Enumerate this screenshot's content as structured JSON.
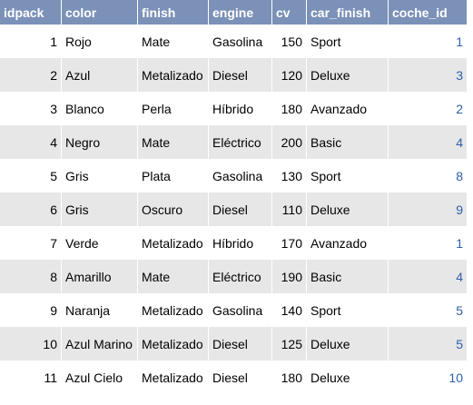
{
  "table": {
    "columns": [
      "idpack",
      "color",
      "finish",
      "engine",
      "cv",
      "car_finish",
      "coche_id"
    ],
    "rows": [
      {
        "idpack": "1",
        "color": "Rojo",
        "finish": "Mate",
        "engine": "Gasolina",
        "cv": "150",
        "car_finish": "Sport",
        "coche_id": "1"
      },
      {
        "idpack": "2",
        "color": "Azul",
        "finish": "Metalizado",
        "engine": "Diesel",
        "cv": "120",
        "car_finish": "Deluxe",
        "coche_id": "3"
      },
      {
        "idpack": "3",
        "color": "Blanco",
        "finish": "Perla",
        "engine": "Híbrido",
        "cv": "180",
        "car_finish": "Avanzado",
        "coche_id": "2"
      },
      {
        "idpack": "4",
        "color": "Negro",
        "finish": "Mate",
        "engine": "Eléctrico",
        "cv": "200",
        "car_finish": "Basic",
        "coche_id": "4"
      },
      {
        "idpack": "5",
        "color": "Gris",
        "finish": "Plata",
        "engine": "Gasolina",
        "cv": "130",
        "car_finish": "Sport",
        "coche_id": "8"
      },
      {
        "idpack": "6",
        "color": "Gris",
        "finish": "Oscuro",
        "engine": "Diesel",
        "cv": "110",
        "car_finish": "Deluxe",
        "coche_id": "9"
      },
      {
        "idpack": "7",
        "color": "Verde",
        "finish": "Metalizado",
        "engine": "Híbrido",
        "cv": "170",
        "car_finish": "Avanzado",
        "coche_id": "1"
      },
      {
        "idpack": "8",
        "color": "Amarillo",
        "finish": "Mate",
        "engine": "Eléctrico",
        "cv": "190",
        "car_finish": "Basic",
        "coche_id": "4"
      },
      {
        "idpack": "9",
        "color": "Naranja",
        "finish": "Metalizado",
        "engine": "Gasolina",
        "cv": "140",
        "car_finish": "Sport",
        "coche_id": "5"
      },
      {
        "idpack": "10",
        "color": "Azul Marino",
        "finish": "Metalizado",
        "engine": "Diesel",
        "cv": "125",
        "car_finish": "Deluxe",
        "coche_id": "5"
      },
      {
        "idpack": "11",
        "color": "Azul Cielo",
        "finish": "Metalizado",
        "engine": "Diesel",
        "cv": "180",
        "car_finish": "Deluxe",
        "coche_id": "10"
      }
    ]
  },
  "colors": {
    "header_bg": "#7b91b8",
    "header_text": "#ffffff",
    "row_alt_bg": "#e7e7e7",
    "link": "#2d5faa"
  }
}
